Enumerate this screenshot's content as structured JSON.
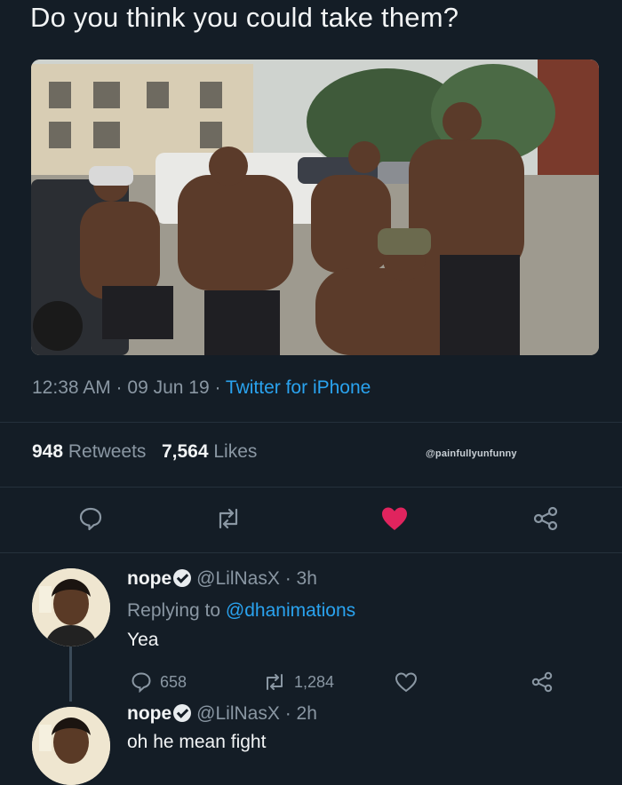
{
  "tweet": {
    "text": "Do you think you could take them?",
    "timestamp": "12:38 AM · 09 Jun 19 · ",
    "source": "Twitter for iPhone",
    "retweets_count": "948",
    "retweets_label": "Retweets",
    "likes_count": "7,564",
    "likes_label": "Likes",
    "watermark": "@painfullyunfunny"
  },
  "icons": {
    "reply": "reply-icon",
    "retweet": "retweet-icon",
    "like": "heart-icon",
    "share": "share-icon"
  },
  "colors": {
    "background": "#141d26",
    "link": "#2aa3ef",
    "like": "#e0245e",
    "muted": "#8a97a3"
  },
  "replies": [
    {
      "name": "nope",
      "handle": "@LilNasX",
      "time": "· 3h",
      "replying_prefix": "Replying to",
      "replying_to": "@dhanimations",
      "text": "Yea",
      "reply_count": "658",
      "retweet_count": "1,284"
    },
    {
      "name": "nope",
      "handle": "@LilNasX",
      "time": "· 2h",
      "text": "oh he mean fight"
    }
  ]
}
